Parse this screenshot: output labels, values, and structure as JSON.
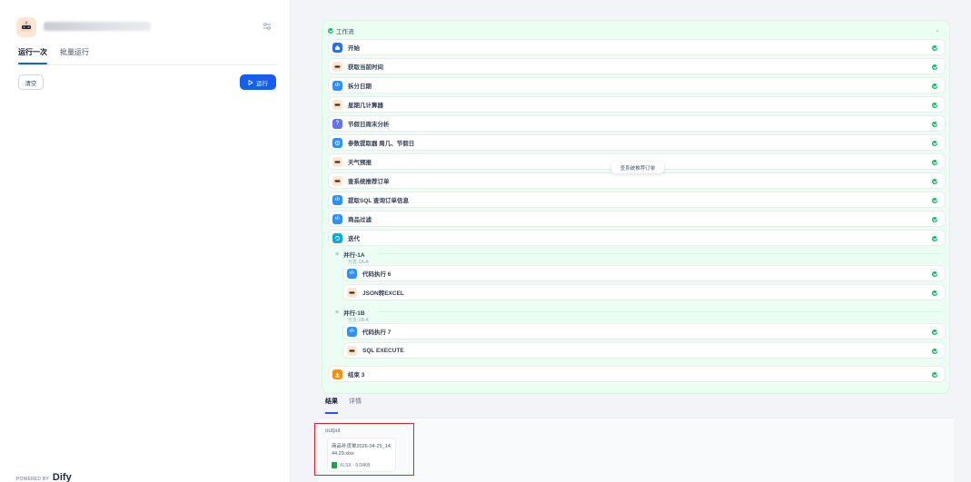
{
  "left": {
    "tabs": [
      "运行一次",
      "批量运行"
    ],
    "clear_label": "清空",
    "run_label": "运行",
    "powered_by": "POWERED BY",
    "brand": "Dify"
  },
  "workflow": {
    "title": "工作流",
    "tooltip": "查系统推荐订单",
    "nodes": [
      {
        "label": "开始",
        "icon": "home-icon"
      },
      {
        "label": "获取当前时间",
        "icon": "tool-avatar-icon"
      },
      {
        "label": "拆分日期",
        "icon": "code-icon"
      },
      {
        "label": "星期几计算器",
        "icon": "tool-avatar-icon"
      },
      {
        "label": "节假日周末分析",
        "icon": "question-classifier-icon"
      },
      {
        "label": "参数提取器 周几、节假日",
        "icon": "parameter-extractor-icon"
      },
      {
        "label": "天气预报",
        "icon": "tool-avatar-icon"
      },
      {
        "label": "查系统推荐订单",
        "icon": "tool-avatar-icon"
      },
      {
        "label": "提取SQL 查询订单信息",
        "icon": "code-icon"
      },
      {
        "label": "商品过滤",
        "icon": "code-icon"
      },
      {
        "label": "迭代",
        "icon": "iteration-icon"
      }
    ],
    "parallel_a": {
      "title": "并行-1A",
      "sub": "分支-1A-A",
      "nodes": [
        {
          "label": "代码执行 6",
          "icon": "code-icon"
        },
        {
          "label": "JSON转EXCEL",
          "icon": "tool-avatar-icon"
        }
      ]
    },
    "parallel_b": {
      "title": "并行-1B",
      "sub": "分支-1B-A",
      "nodes": [
        {
          "label": "代码执行 7",
          "icon": "code-icon"
        },
        {
          "label": "SQL EXECUTE",
          "icon": "tool-avatar-icon"
        }
      ]
    },
    "end_node": {
      "label": "结束 3",
      "icon": "end-icon"
    }
  },
  "result": {
    "tabs": [
      "结果",
      "详情"
    ],
    "output_label": "output",
    "file_name": "商品补货单2026-04-25_14:44:29.xlsx",
    "file_meta": "XLSX · 9.04KB"
  },
  "colors": {
    "accent": "#155eef",
    "success": "#12b76a",
    "workflow_bg": "#ecfdf3",
    "highlight": "#e02424"
  }
}
